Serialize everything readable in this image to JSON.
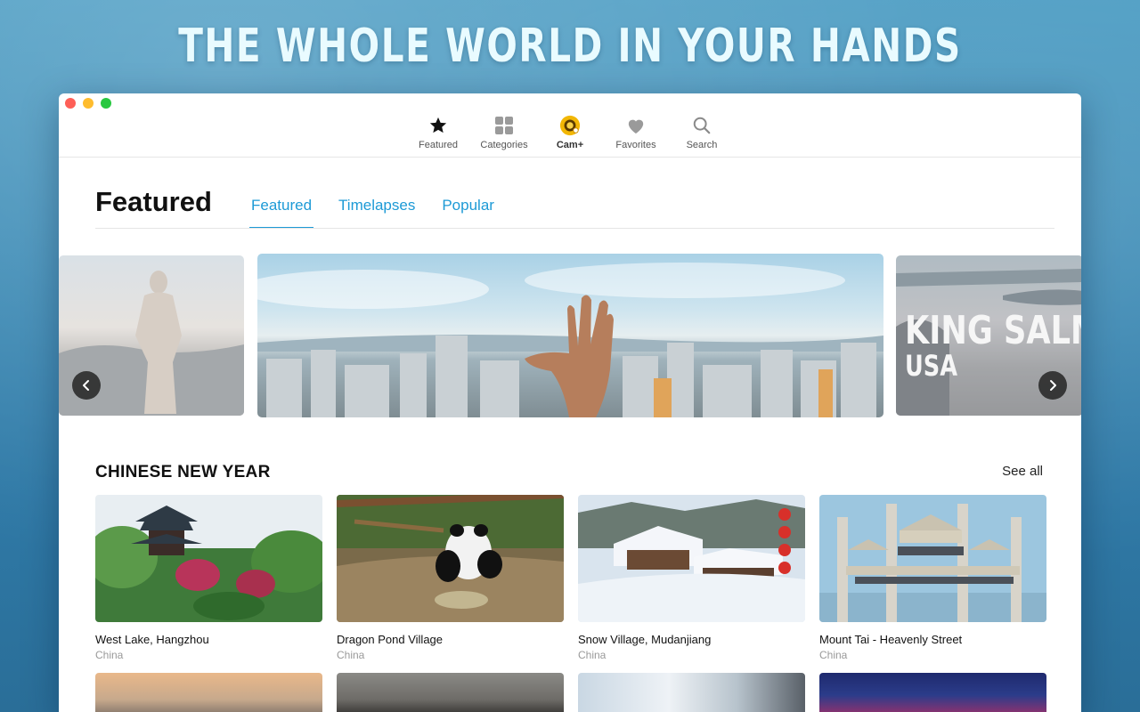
{
  "headline": "THE WHOLE WORLD IN YOUR HANDS",
  "toolbar": {
    "items": [
      {
        "label": "Featured",
        "icon": "star-icon"
      },
      {
        "label": "Categories",
        "icon": "grid-icon"
      },
      {
        "label": "Cam+",
        "icon": "cam-plus-icon"
      },
      {
        "label": "Favorites",
        "icon": "heart-icon"
      },
      {
        "label": "Search",
        "icon": "search-icon"
      }
    ]
  },
  "page": {
    "title": "Featured",
    "tabs": [
      {
        "label": "Featured",
        "active": true
      },
      {
        "label": "Timelapses",
        "active": false
      },
      {
        "label": "Popular",
        "active": false
      }
    ]
  },
  "carousel": {
    "right_slide_line1": "KING SALMON",
    "right_slide_line2": "USA"
  },
  "section": {
    "title": "CHINESE NEW YEAR",
    "see_all": "See all",
    "cards": [
      {
        "title": "West Lake, Hangzhou",
        "country": "China"
      },
      {
        "title": "Dragon Pond Village",
        "country": "China"
      },
      {
        "title": "Snow Village, Mudanjiang",
        "country": "China"
      },
      {
        "title": "Mount Tai - Heavenly Street",
        "country": "China"
      }
    ]
  },
  "colors": {
    "accent": "#1d9ad6",
    "background": "#3f8db7"
  }
}
